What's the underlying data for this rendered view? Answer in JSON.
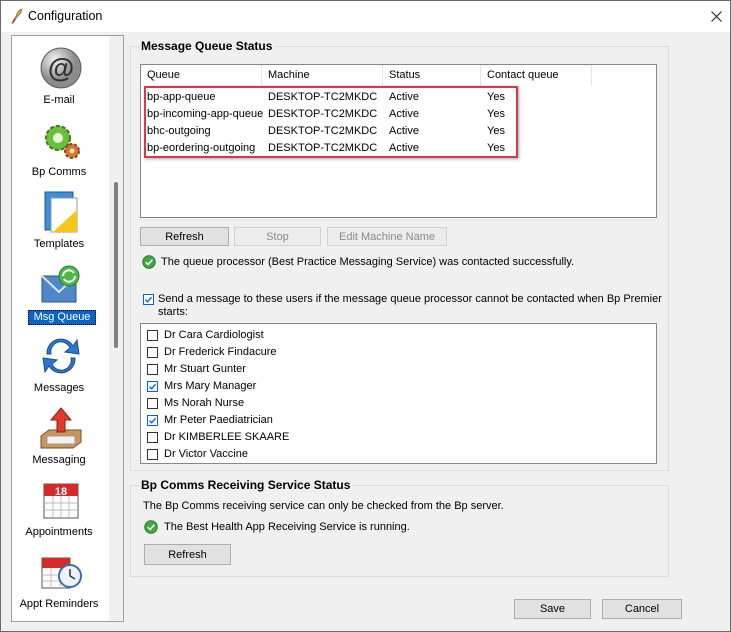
{
  "window": {
    "title": "Configuration"
  },
  "sidebar": {
    "items": [
      {
        "label": "E-mail",
        "icon": "email-at-icon"
      },
      {
        "label": "Bp Comms",
        "icon": "gears-icon"
      },
      {
        "label": "Templates",
        "icon": "templates-icon"
      },
      {
        "label": "Msg Queue",
        "icon": "message-queue-icon",
        "selected": true
      },
      {
        "label": "Messages",
        "icon": "messages-refresh-icon"
      },
      {
        "label": "Messaging",
        "icon": "messaging-tray-icon"
      },
      {
        "label": "Appointments",
        "icon": "calendar-icon"
      },
      {
        "label": "Appt Reminders",
        "icon": "calendar-clock-icon"
      }
    ]
  },
  "mq": {
    "title": "Message Queue Status",
    "columns": [
      "Queue",
      "Machine",
      "Status",
      "Contact queue"
    ],
    "rows": [
      {
        "queue": "bp-app-queue",
        "machine": "DESKTOP-TC2MKDC",
        "status": "Active",
        "contact": "Yes"
      },
      {
        "queue": "bp-incoming-app-queue",
        "machine": "DESKTOP-TC2MKDC",
        "status": "Active",
        "contact": "Yes"
      },
      {
        "queue": "bhc-outgoing",
        "machine": "DESKTOP-TC2MKDC",
        "status": "Active",
        "contact": "Yes"
      },
      {
        "queue": "bp-eordering-outgoing",
        "machine": "DESKTOP-TC2MKDC",
        "status": "Active",
        "contact": "Yes"
      }
    ],
    "refresh_label": "Refresh",
    "stop_label": "Stop",
    "edit_label": "Edit Machine Name",
    "status_text": "The queue processor (Best Practice Messaging Service) was contacted successfully.",
    "notify_label_line1": "Send a message to these users if the message queue processor cannot be contacted when Bp Premier",
    "notify_label_line2": "starts:",
    "users": [
      {
        "name": "Dr Cara Cardiologist",
        "checked": false
      },
      {
        "name": "Dr Frederick Findacure",
        "checked": false
      },
      {
        "name": "Mr Stuart Gunter",
        "checked": false
      },
      {
        "name": "Mrs Mary Manager",
        "checked": true
      },
      {
        "name": "Ms Norah Nurse",
        "checked": false
      },
      {
        "name": "Mr Peter Paediatrician",
        "checked": true
      },
      {
        "name": "Dr KIMBERLEE SKAARE",
        "checked": false
      },
      {
        "name": "Dr Victor Vaccine",
        "checked": false
      }
    ]
  },
  "comms": {
    "title": "Bp Comms Receiving Service Status",
    "info": "The Bp Comms receiving service can only be checked from the Bp server.",
    "status_text": "The Best Health App Receiving Service is running.",
    "refresh_label": "Refresh"
  },
  "footer": {
    "save_label": "Save",
    "cancel_label": "Cancel"
  },
  "colors": {
    "accent": "#0a64c8",
    "highlight": "#d9374a",
    "ok_green": "#3fa83f"
  }
}
